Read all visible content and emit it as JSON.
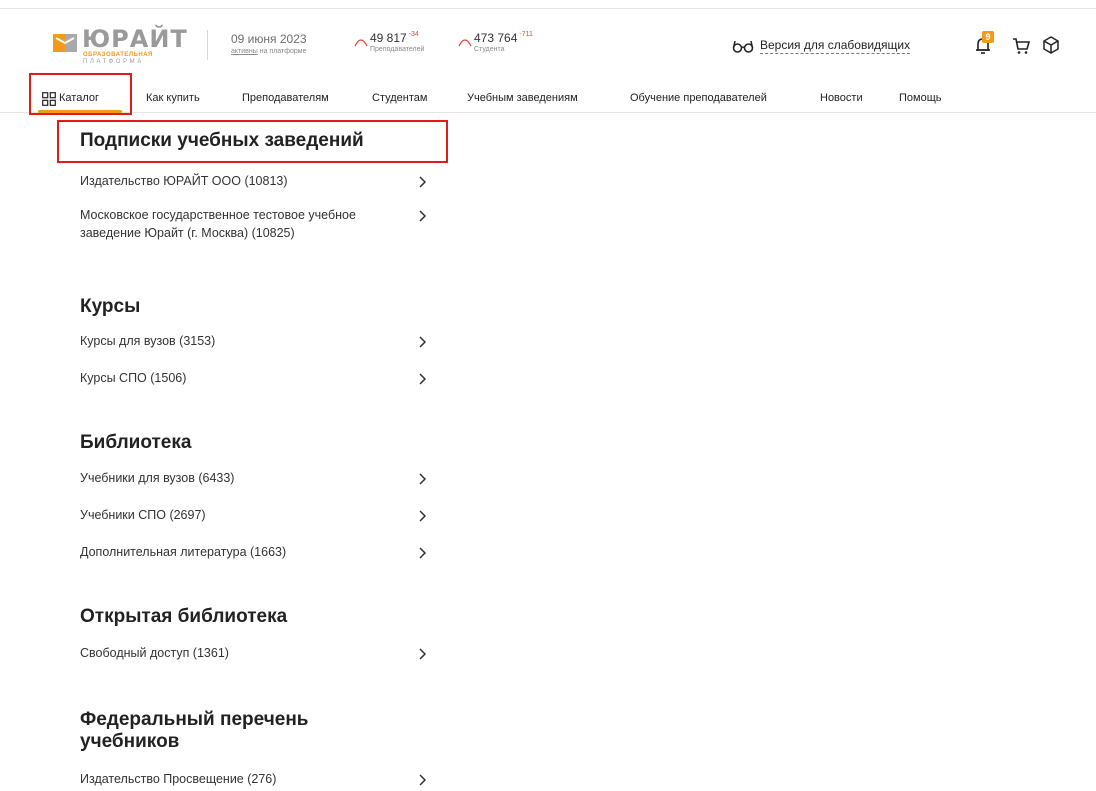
{
  "header": {
    "logo": {
      "word": "ЮРАЙТ",
      "line1": "ОБРАЗОВАТЕЛЬНАЯ",
      "line2": "ПЛАТФОРМА"
    },
    "date": "09 июня 2023",
    "date_sub_underlined": "активны",
    "date_sub_rest": " на платформе",
    "stats": [
      {
        "value": "49 817",
        "delta": "-34",
        "label": "Преподавателей"
      },
      {
        "value": "473 764",
        "delta": "-711",
        "label": "Студента"
      }
    ],
    "accessibility_label": "Версия для слабовидящих",
    "notification_count": "9",
    "icons": [
      "glasses-icon",
      "bell-icon",
      "cart-icon",
      "box-icon"
    ],
    "accent_color": "#f39a1b",
    "highlight_color": "#e11a1a"
  },
  "nav": {
    "items": [
      {
        "label": "Каталог"
      },
      {
        "label": "Как купить"
      },
      {
        "label": "Преподавателям"
      },
      {
        "label": "Студентам"
      },
      {
        "label": "Учебным заведениям"
      },
      {
        "label": "Обучение преподавателей"
      },
      {
        "label": "Новости"
      },
      {
        "label": "Помощь"
      }
    ]
  },
  "sections": [
    {
      "title": "Подписки учебных заведений",
      "items": [
        {
          "label": "Издательство ЮРАЙТ ООО (10813)"
        },
        {
          "label": "Московское государственное тестовое учебное заведение Юрайт (г. Москва) (10825)"
        }
      ]
    },
    {
      "title": "Курсы",
      "items": [
        {
          "label": "Курсы для вузов (3153)"
        },
        {
          "label": "Курсы СПО (1506)"
        }
      ]
    },
    {
      "title": "Библиотека",
      "items": [
        {
          "label": "Учебники для вузов (6433)"
        },
        {
          "label": "Учебники СПО (2697)"
        },
        {
          "label": "Дополнительная литература (1663)"
        }
      ]
    },
    {
      "title": "Открытая библиотека",
      "items": [
        {
          "label": "Свободный доступ (1361)"
        }
      ]
    },
    {
      "title": "Федеральный перечень учебников",
      "items": [
        {
          "label": "Издательство Просвещение (276)"
        }
      ]
    }
  ]
}
